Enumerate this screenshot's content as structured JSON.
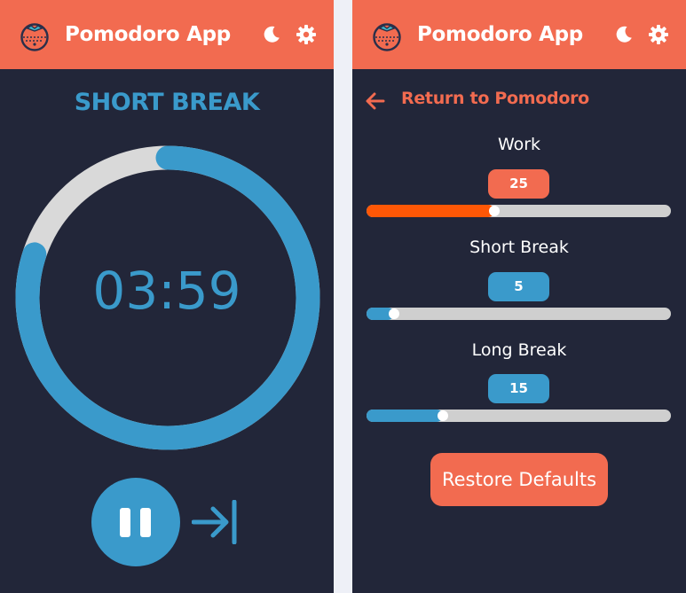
{
  "colors": {
    "brand": "#f26b50",
    "accent_blue": "#3a9acb",
    "background": "#222639",
    "work_slider": "#fe5706",
    "track": "#cfcfcf"
  },
  "timer_view": {
    "header": {
      "title": "Pomodoro App",
      "logo_icon": "tomato-icon",
      "theme_icon": "moon-icon",
      "settings_icon": "gear-icon"
    },
    "mode_title": "SHORT BREAK",
    "time": "03:59",
    "progress_fraction": 0.2,
    "pause_icon": "pause-icon",
    "skip_icon": "skip-icon"
  },
  "settings_view": {
    "header": {
      "title": "Pomodoro App",
      "logo_icon": "tomato-icon",
      "theme_icon": "moon-icon",
      "settings_icon": "gear-icon"
    },
    "return_label": "Return to Pomodoro",
    "return_icon": "arrow-left-icon",
    "settings": [
      {
        "label": "Work",
        "value": "25",
        "fraction": 0.42,
        "color": "#fe5706",
        "badge_color": "#f26b50"
      },
      {
        "label": "Short Break",
        "value": "5",
        "fraction": 0.09,
        "color": "#3a9acb",
        "badge_color": "#3a9acb"
      },
      {
        "label": "Long Break",
        "value": "15",
        "fraction": 0.25,
        "color": "#3a9acb",
        "badge_color": "#3a9acb"
      }
    ],
    "restore_label": "Restore Defaults"
  }
}
